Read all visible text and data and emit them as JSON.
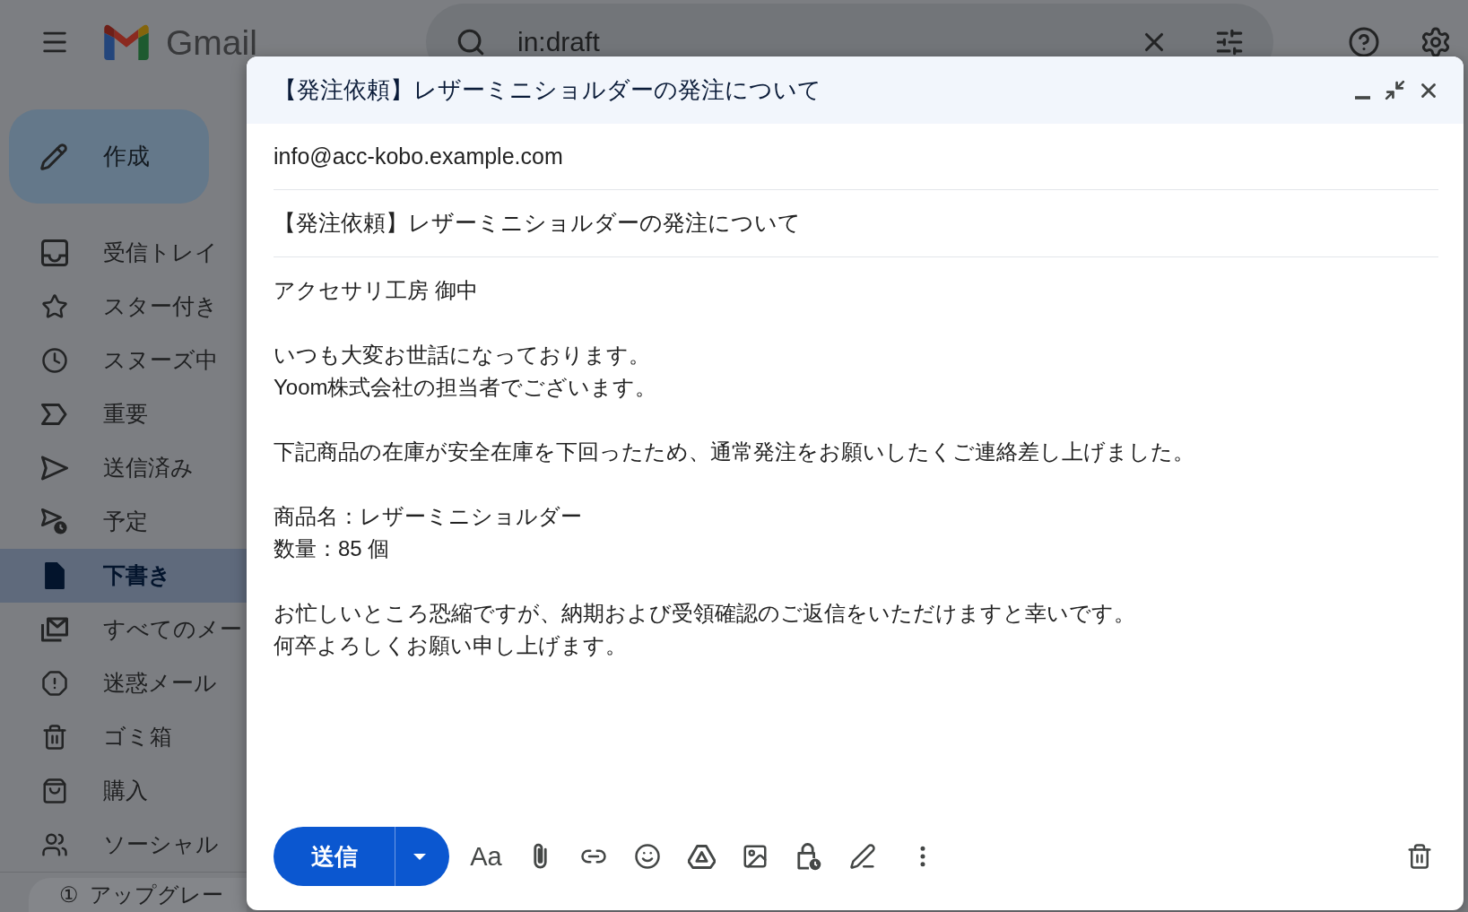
{
  "top_bar": {
    "app_name": "Gmail",
    "search": {
      "value": "in:draft"
    }
  },
  "sidebar": {
    "compose_button": "作成",
    "items": [
      {
        "label": "受信トレイ",
        "selected": false
      },
      {
        "label": "スター付き",
        "selected": false
      },
      {
        "label": "スヌーズ中",
        "selected": false
      },
      {
        "label": "重要",
        "selected": false
      },
      {
        "label": "送信済み",
        "selected": false
      },
      {
        "label": "予定",
        "selected": false
      },
      {
        "label": "下書き",
        "selected": true
      },
      {
        "label": "すべてのメー",
        "selected": false
      },
      {
        "label": "迷惑メール",
        "selected": false
      },
      {
        "label": "ゴミ箱",
        "selected": false
      },
      {
        "label": "購入",
        "selected": false
      },
      {
        "label": "ソーシャル",
        "selected": false
      }
    ],
    "upgrade": {
      "icon": "①",
      "label": "アップグレー"
    }
  },
  "compose": {
    "title": "【発注依頼】レザーミニショルダーの発注について",
    "to": "info@acc-kobo.example.com",
    "subject": "【発注依頼】レザーミニショルダーの発注について",
    "body": [
      [
        "アクセサリ工房 御中"
      ],
      [
        "いつも大変お世話になっております。",
        "Yoom株式会社の担当者でございます。"
      ],
      [
        "下記商品の在庫が安全在庫を下回ったため、通常発注をお願いしたくご連絡差し上げました。"
      ],
      [
        "商品名：レザーミニショルダー",
        "数量：85 個"
      ],
      [
        "お忙しいところ恐縮ですが、納期および受領確認のご返信をいただけますと幸いです。",
        "何卒よろしくお願い申し上げます。"
      ]
    ],
    "send_button": "送信",
    "format_button": "Aa"
  }
}
